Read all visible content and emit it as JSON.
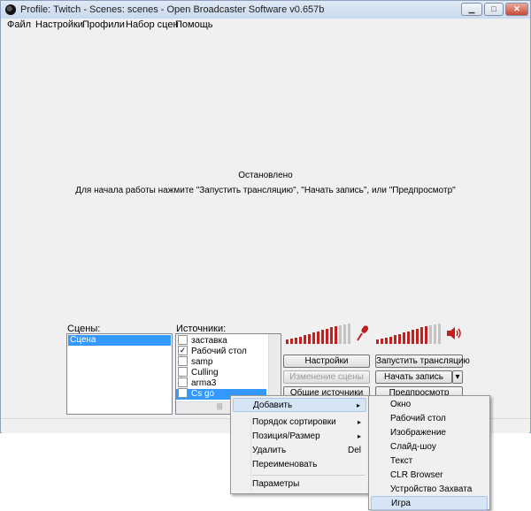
{
  "window": {
    "title": "Profile: Twitch - Scenes: scenes - Open Broadcaster Software v0.657b",
    "controls": {
      "minimize": "▁",
      "maximize": "□",
      "close": "✕"
    }
  },
  "menubar": [
    "Файл",
    "Настройки",
    "Профили",
    "Набор сцен",
    "Помощь"
  ],
  "preview": {
    "status": "Остановлено",
    "hint": "Для начала работы нажмите \"Запустить трансляцию\", \"Начать запись\", или \"Предпросмотр\""
  },
  "scenes": {
    "label": "Сцены:",
    "items": [
      "Сцена"
    ]
  },
  "sources": {
    "label": "Источники:",
    "items": [
      {
        "name": "заставка",
        "checked": ""
      },
      {
        "name": "Рабочий стол",
        "checked": "✓"
      },
      {
        "name": "samp",
        "checked": ""
      },
      {
        "name": "Culling",
        "checked": ""
      },
      {
        "name": "arma3",
        "checked": ""
      },
      {
        "name": "Cs go",
        "checked": "✓"
      }
    ],
    "hscroll_grip": "|||"
  },
  "buttons": {
    "settings": "Настройки",
    "start_stream": "Запустить трансляцию",
    "edit_scene": "Изменение сцены",
    "start_record": "Начать запись",
    "record_dropdown": "▾",
    "global_sources": "Общие источники",
    "preview": "Предпросмотр"
  },
  "icons": {
    "mic": "microphone-icon",
    "speaker": "speaker-icon"
  },
  "colors": {
    "meter_active": "#c21f1f",
    "meter_inactive": "#c3c3c3",
    "selection": "#3399ff"
  },
  "context_menu": {
    "items": [
      "Добавить",
      "Порядок сортировки",
      "Позиция/Размер",
      "Удалить",
      "Переименовать",
      "Параметры"
    ],
    "delete_shortcut": "Del",
    "arrow": "▸"
  },
  "submenu": {
    "items": [
      "Окно",
      "Рабочий стол",
      "Изображение",
      "Слайд-шоу",
      "Текст",
      "CLR Browser",
      "Устройство Захвата",
      "Игра"
    ]
  }
}
